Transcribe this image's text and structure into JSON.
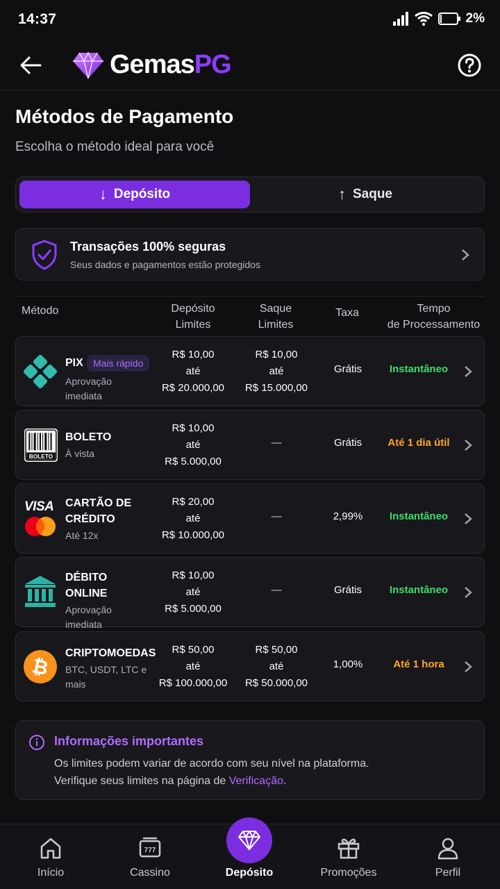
{
  "status_bar": {
    "time": "14:37",
    "battery": "2%"
  },
  "header": {
    "logo_gems": "Gemas",
    "logo_pg": "PG"
  },
  "page": {
    "title": "Métodos de Pagamento",
    "subtitle": "Escolha o método ideal para você"
  },
  "toggle": {
    "deposit_label": "Depósito",
    "withdraw_label": "Saque",
    "active": "deposit"
  },
  "secure": {
    "title": "Transações 100% seguras",
    "subtitle": "Seus dados e pagamentos estão protegidos"
  },
  "table": {
    "headers": {
      "method": "Método",
      "deposit_l1": "Depósito",
      "deposit_l2": "Limites",
      "withdraw_l1": "Saque",
      "withdraw_l2": "Limites",
      "fee": "Taxa",
      "time_l1": "Tempo",
      "time_l2": "de Processamento"
    },
    "rows": [
      {
        "name": "PIX",
        "badge": "Mais rápido",
        "desc": "Aprovação imediata",
        "dep_min": "R$ 10,00",
        "dep_ate": "até",
        "dep_max": "R$ 20.000,00",
        "saq_min": "R$ 10,00",
        "saq_ate": "até",
        "saq_max": "R$ 15.000,00",
        "fee": "Grátis",
        "time": "Instantâneo",
        "time_color": "#3ddc6d"
      },
      {
        "name": "BOLETO",
        "desc": "À vista",
        "icon_text": "BOLETO",
        "dep_min": "R$ 10,00",
        "dep_ate": "até",
        "dep_max": "R$ 5.000,00",
        "saq": "—",
        "fee": "Grátis",
        "time": "Até 1 dia útil",
        "time_color": "#ffa726"
      },
      {
        "name_l1": "CARTÃO DE",
        "name_l2": "CRÉDITO",
        "desc": "Até 12x",
        "icon_text": "VISA",
        "dep_min": "R$ 20,00",
        "dep_ate": "até",
        "dep_max": "R$ 10.000,00",
        "saq": "—",
        "fee": "2,99%",
        "time": "Instantâneo",
        "time_color": "#3ddc6d"
      },
      {
        "name_l1": "DÉBITO",
        "name_l2": "ONLINE",
        "desc": "Aprovação imediata",
        "dep_min": "R$ 10,00",
        "dep_ate": "até",
        "dep_max": "R$ 5.000,00",
        "saq": "—",
        "fee": "Grátis",
        "time": "Instantâneo",
        "time_color": "#3ddc6d"
      },
      {
        "name": "CRIPTOMOEDAS",
        "desc_l1": "BTC, USDT, LTC e",
        "desc_l2": "mais",
        "dep_min": "R$ 50,00",
        "dep_ate": "até",
        "dep_max": "R$ 100.000,00",
        "saq_min": "R$ 50,00",
        "saq_ate": "até",
        "saq_max": "R$ 50.000,00",
        "fee": "1,00%",
        "time": "Até 1 hora",
        "time_color": "#ffa726"
      }
    ]
  },
  "info": {
    "title": "Informações importantes",
    "line1": "Os limites podem variar de acordo com seu nível na plataforma.",
    "line2_prefix": "Verifique seus limites na página de ",
    "line2_link": "Verificação",
    "line2_suffix": "."
  },
  "nav": {
    "home": "Início",
    "casino": "Cassino",
    "deposit": "Depósito",
    "promos": "Promoções",
    "profile": "Perfil",
    "active": "deposit"
  },
  "colors": {
    "accent": "#7a2ee0",
    "green": "#3ddc6d",
    "orange": "#ffa726",
    "link": "#b26bff"
  }
}
